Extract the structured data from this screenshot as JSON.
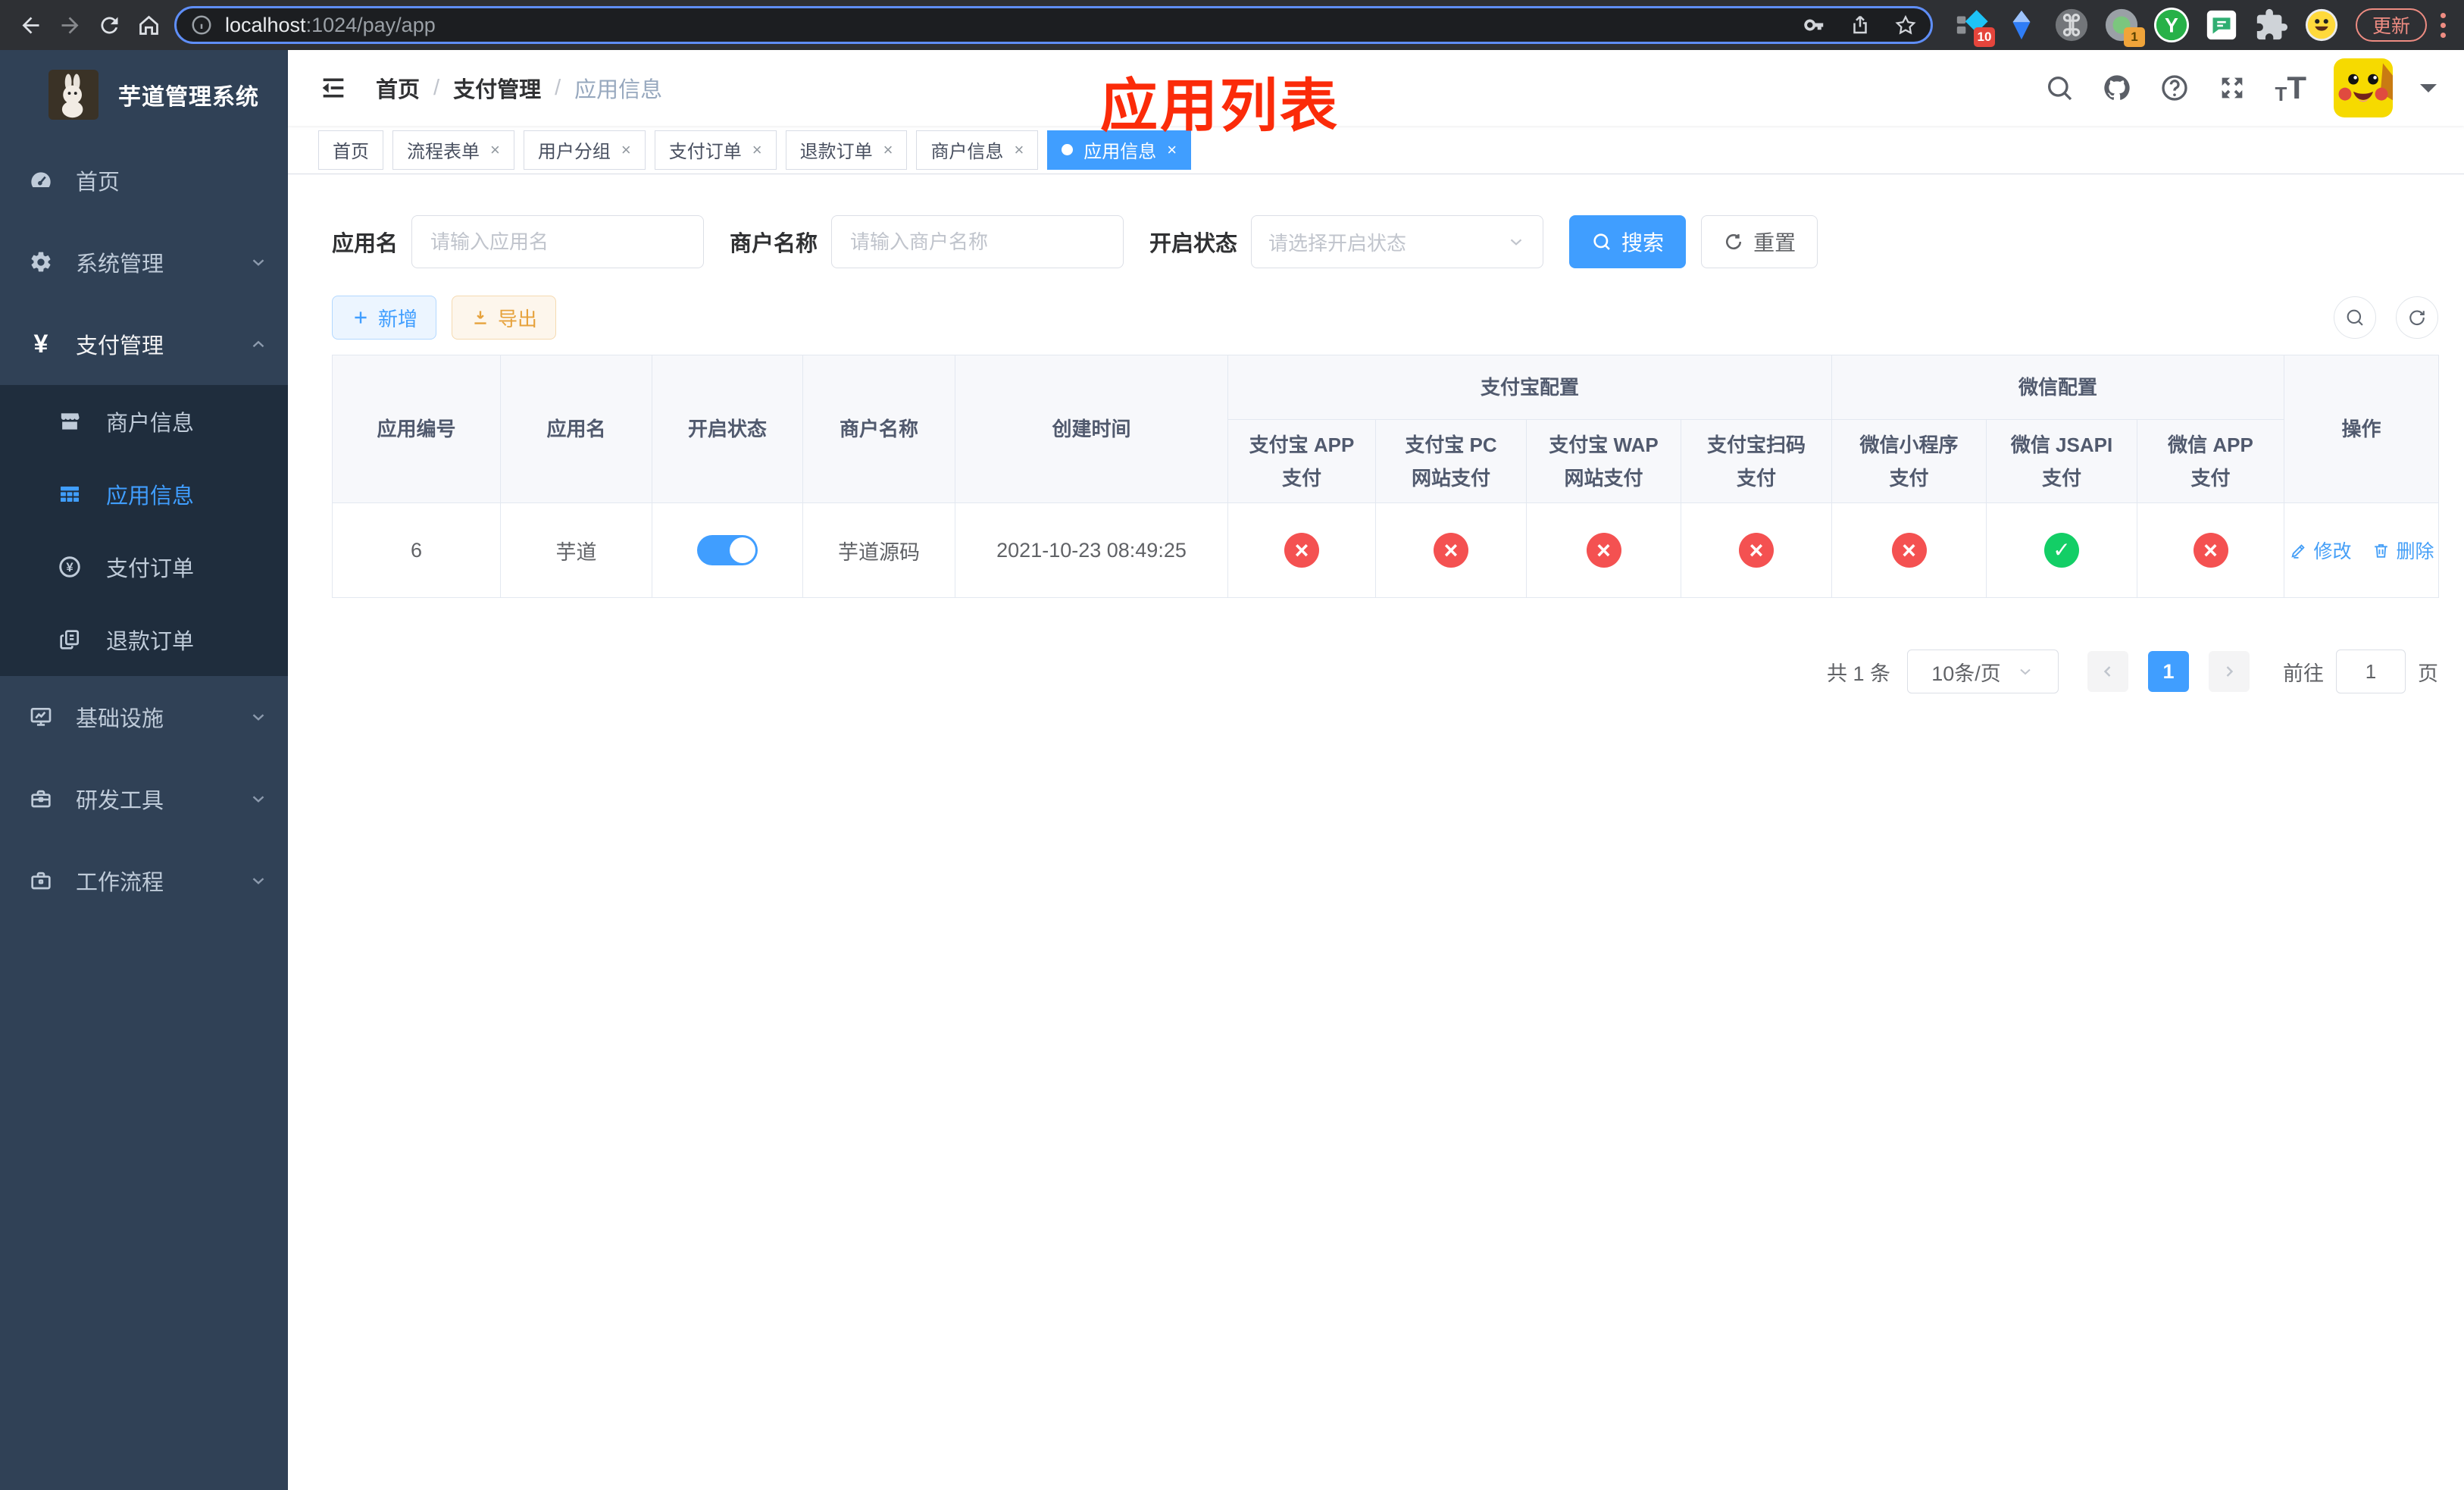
{
  "browser": {
    "url": {
      "host": "localhost",
      "path": ":1024/pay/app"
    },
    "update_button": "更新",
    "ext_badge_blue_diamond": "10",
    "ext_badge_recorder": "1",
    "ext_y_letter": "Y"
  },
  "sidebar": {
    "title": "芋道管理系统",
    "menu_top": [
      {
        "label": "首页"
      },
      {
        "label": "系统管理"
      },
      {
        "label": "支付管理"
      }
    ],
    "submenu": [
      {
        "label": "商户信息"
      },
      {
        "label": "应用信息"
      },
      {
        "label": "支付订单"
      },
      {
        "label": "退款订单"
      }
    ],
    "menu_bottom": [
      {
        "label": "基础设施"
      },
      {
        "label": "研发工具"
      },
      {
        "label": "工作流程"
      }
    ]
  },
  "navbar": {
    "breadcrumb": [
      "首页",
      "支付管理",
      "应用信息"
    ],
    "annotation": "应用列表"
  },
  "tabs": [
    {
      "label": "首页"
    },
    {
      "label": "流程表单"
    },
    {
      "label": "用户分组"
    },
    {
      "label": "支付订单"
    },
    {
      "label": "退款订单"
    },
    {
      "label": "商户信息"
    },
    {
      "label": "应用信息"
    }
  ],
  "filters": {
    "app_name_label": "应用名",
    "app_name_placeholder": "请输入应用名",
    "merchant_label": "商户名称",
    "merchant_placeholder": "请输入商户名称",
    "status_label": "开启状态",
    "status_placeholder": "请选择开启状态",
    "search_label": "搜索",
    "reset_label": "重置"
  },
  "toolbar": {
    "add_label": "新增",
    "export_label": "导出"
  },
  "table": {
    "columns": [
      "应用编号",
      "应用名",
      "开启状态",
      "商户名称",
      "创建时间"
    ],
    "groups": {
      "alipay": "支付宝配置",
      "wechat": "微信配置"
    },
    "pay_columns": [
      "支付宝 APP 支付",
      "支付宝 PC 网站支付",
      "支付宝 WAP 网站支付",
      "支付宝扫码支付",
      "微信小程序支付",
      "微信 JSAPI 支付",
      "微信 APP 支付"
    ],
    "action_column": "操作",
    "row": {
      "id": "6",
      "name": "芋道",
      "enabled": true,
      "merchant": "芋道源码",
      "created_at": "2021-10-23 08:49:25",
      "configs": [
        {
          "state": "off"
        },
        {
          "state": "off"
        },
        {
          "state": "off"
        },
        {
          "state": "off"
        },
        {
          "state": "off"
        },
        {
          "state": "on"
        },
        {
          "state": "off"
        }
      ],
      "edit_label": "修改",
      "delete_label": "删除"
    }
  },
  "pagination": {
    "total": "共 1 条",
    "page_size": "10条/页",
    "current_page": "1",
    "goto_label": "前往",
    "goto_value": "1",
    "page_label": "页"
  },
  "colors": {
    "primary": "#409eff",
    "success": "#13ce66",
    "danger": "#f45151",
    "warning": "#e6a23c",
    "annotation": "#fb2b09",
    "sidebar_bg": "#304156",
    "submenu_bg": "#1f2d3d"
  }
}
